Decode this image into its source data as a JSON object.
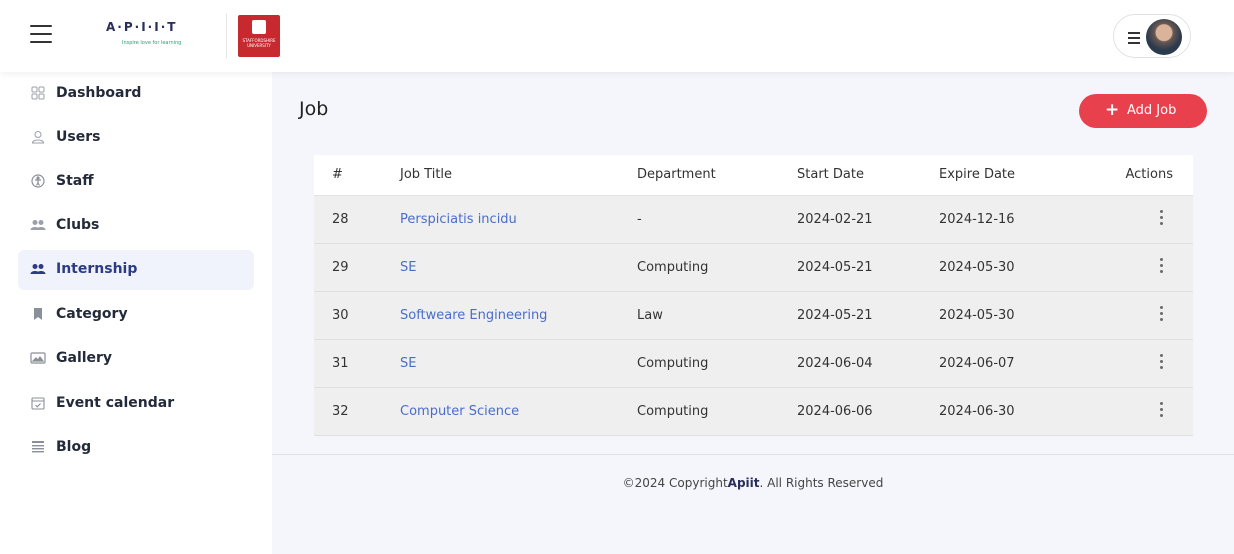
{
  "brand": {
    "logo_text": "A·P·I·I·T",
    "logo_tagline": "Inspire love for learning",
    "uni_text": "STAFFORDSHIRE UNIVERSITY"
  },
  "sidebar": {
    "items": [
      {
        "label": "Dashboard",
        "icon": "grid-icon"
      },
      {
        "label": "Users",
        "icon": "user-icon"
      },
      {
        "label": "Staff",
        "icon": "accessibility-icon"
      },
      {
        "label": "Clubs",
        "icon": "group-icon"
      },
      {
        "label": "Internship",
        "icon": "group-icon",
        "active": true
      },
      {
        "label": "Category",
        "icon": "bookmark-icon"
      },
      {
        "label": "Gallery",
        "icon": "image-icon"
      },
      {
        "label": "Event calendar",
        "icon": "calendar-icon"
      },
      {
        "label": "Blog",
        "icon": "blog-icon"
      }
    ]
  },
  "main": {
    "title": "Job",
    "add_button": {
      "icon": "+",
      "label": "Add Job"
    },
    "table": {
      "headers": [
        "#",
        "Job Title",
        "Department",
        "Start Date",
        "Expire Date",
        "Actions"
      ],
      "rows": [
        [
          "28",
          "Perspiciatis incidu",
          "-",
          "2024-02-21",
          "2024-12-16"
        ],
        [
          "29",
          "SE",
          "Computing",
          "2024-05-21",
          "2024-05-30"
        ],
        [
          "30",
          "Softweare Engineering",
          "Law",
          "2024-05-21",
          "2024-05-30"
        ],
        [
          "31",
          "SE",
          "Computing",
          "2024-06-04",
          "2024-06-07"
        ],
        [
          "32",
          "Computer Science",
          "Computing",
          "2024-06-06",
          "2024-06-30"
        ]
      ]
    }
  },
  "footer": {
    "prefix": "©2024 Copyright",
    "brand": "Apiit",
    "suffix": ". All Rights Reserved"
  },
  "colors": {
    "accent": "#e8404c",
    "link": "#4a6dc9",
    "nav_active_bg": "#f0f3fb"
  }
}
